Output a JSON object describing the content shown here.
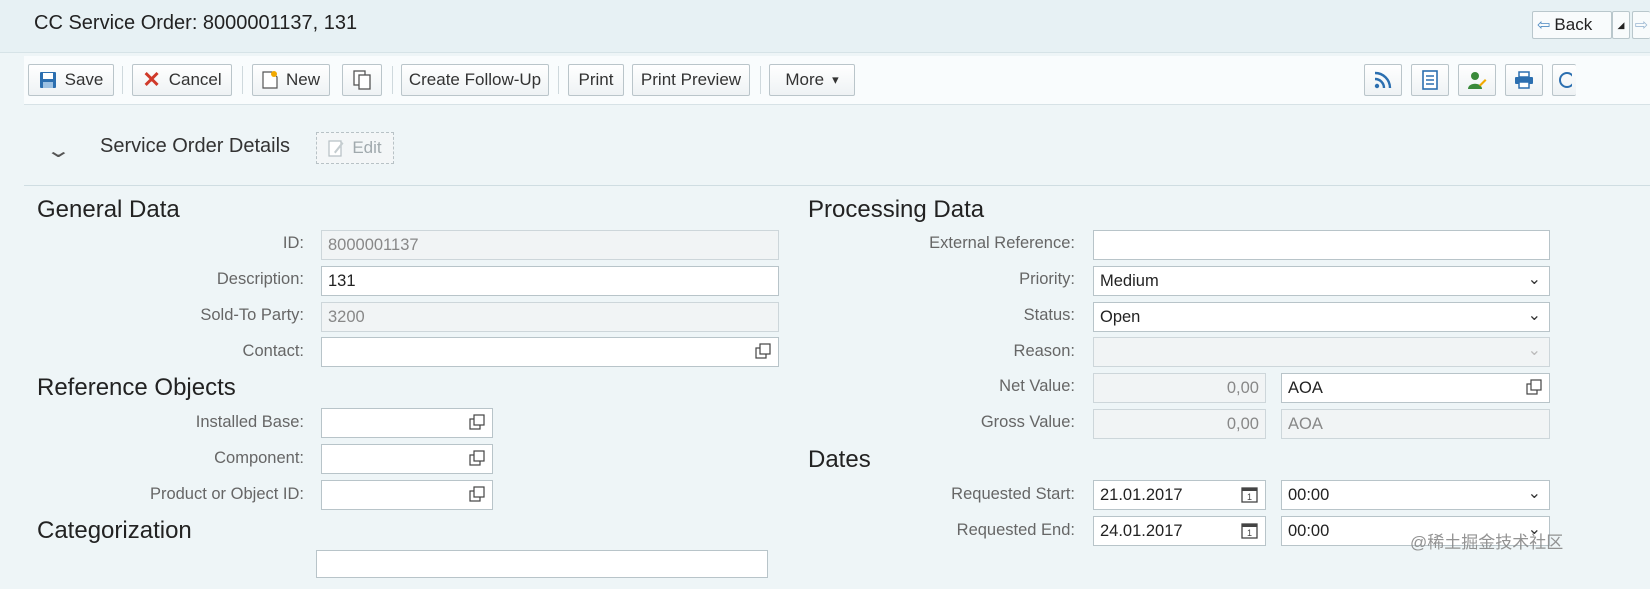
{
  "window": {
    "title": "CC Service Order: 8000001137, 131",
    "back_label": "Back"
  },
  "toolbar": {
    "save": "Save",
    "cancel": "Cancel",
    "new": "New",
    "create_follow_up": "Create Follow-Up",
    "print": "Print",
    "print_preview": "Print Preview",
    "more": "More"
  },
  "section": {
    "title": "Service Order Details",
    "edit": "Edit"
  },
  "general_data": {
    "title": "General Data",
    "fields": [
      {
        "label": "ID:",
        "value": "8000001137"
      },
      {
        "label": "Description:",
        "value": "131"
      },
      {
        "label": "Sold-To Party:",
        "value": "3200"
      },
      {
        "label": "Contact:",
        "value": ""
      }
    ]
  },
  "reference_objects": {
    "title": "Reference Objects",
    "fields": [
      {
        "label": "Installed Base:",
        "value": ""
      },
      {
        "label": "Component:",
        "value": ""
      },
      {
        "label": "Product or Object ID:",
        "value": ""
      }
    ]
  },
  "categorization": {
    "title": "Categorization"
  },
  "processing_data": {
    "title": "Processing Data",
    "external_reference": {
      "label": "External Reference:",
      "value": ""
    },
    "priority": {
      "label": "Priority:",
      "value": "Medium"
    },
    "status": {
      "label": "Status:",
      "value": "Open"
    },
    "reason": {
      "label": "Reason:",
      "value": ""
    },
    "net_value": {
      "label": "Net Value:",
      "value": "0,00",
      "currency": "AOA"
    },
    "gross_value": {
      "label": "Gross Value:",
      "value": "0,00",
      "currency": "AOA"
    }
  },
  "dates": {
    "title": "Dates",
    "requested_start": {
      "label": "Requested Start:",
      "date": "21.01.2017",
      "time": "00:00"
    },
    "requested_end": {
      "label": "Requested End:",
      "date": "24.01.2017",
      "time": "00:00"
    }
  },
  "watermark": "@稀土掘金技术社区",
  "colors": {
    "background": "#eef5f7",
    "icon_blue": "#2c6fb0",
    "cancel_red": "#d03a2a",
    "notify_green": "#3a8a3a"
  }
}
